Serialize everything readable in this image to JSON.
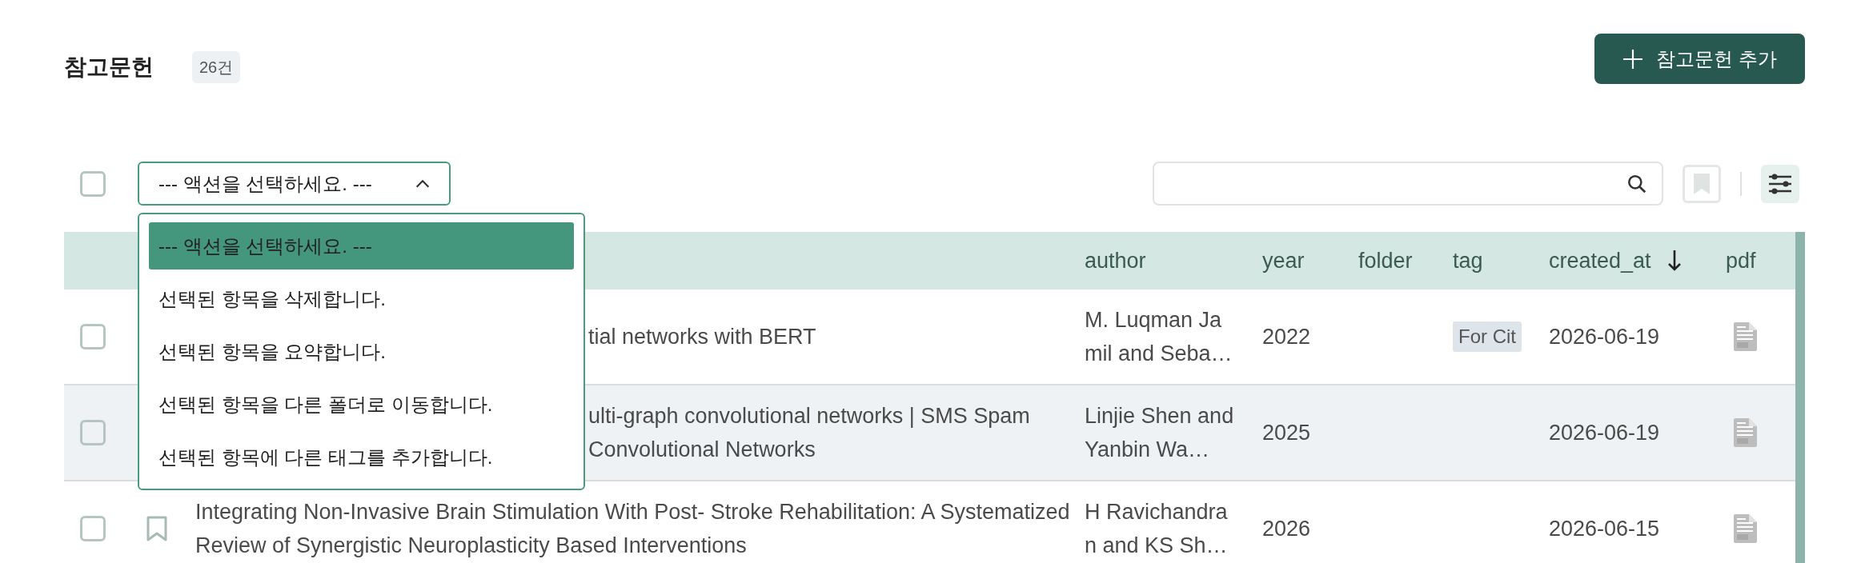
{
  "header": {
    "title": "참고문헌",
    "count": "26건",
    "add_button": "참고문헌 추가"
  },
  "toolbar": {
    "select_all": {
      "checked": false
    },
    "action_select": {
      "value": "--- 액션을 선택하세요. ---",
      "expanded": true,
      "options": [
        {
          "label": "--- 액션을 선택하세요. ---",
          "selected": true
        },
        {
          "label": "선택된 항목을 삭제합니다.",
          "selected": false
        },
        {
          "label": "선택된 항목을 요약합니다.",
          "selected": false
        },
        {
          "label": "선택된 항목을 다른 폴더로 이동합니다.",
          "selected": false
        },
        {
          "label": "선택된 항목에 다른 태그를 추가합니다.",
          "selected": false
        }
      ]
    }
  },
  "table": {
    "columns": [
      {
        "label": "author"
      },
      {
        "label": "year"
      },
      {
        "label": "folder"
      },
      {
        "label": "tag"
      },
      {
        "label": "created_at",
        "sort_descending": true
      },
      {
        "label": "pdf"
      }
    ],
    "rows": [
      {
        "checked": false,
        "highlighted": false,
        "title_fragments": [
          "tial networks with BERT"
        ],
        "author": "M. Luqman Jamil and Seba…",
        "year": "2022",
        "tags": [
          "For Cit"
        ],
        "created_at": "2026-06-19",
        "pdf": true
      },
      {
        "checked": false,
        "highlighted": true,
        "title_fragments": [
          "ulti-graph convolutional networks | SMS Spam",
          "Convolutional Networks"
        ],
        "author": "Linjie Shen and Yanbin Wa…",
        "year": "2025",
        "created_at": "2026-06-19",
        "pdf": true
      },
      {
        "checked": false,
        "highlighted": false,
        "bookmarked": false,
        "title": "Integrating Non-Invasive Brain Stimulation With Post- Stroke Rehabilitation: A Systematized Review of Synergistic Neuroplasticity Based Interventions",
        "author": "H Ravichandran and KS Sh…",
        "year": "2026",
        "created_at": "2026-06-15",
        "pdf": true
      }
    ]
  }
}
